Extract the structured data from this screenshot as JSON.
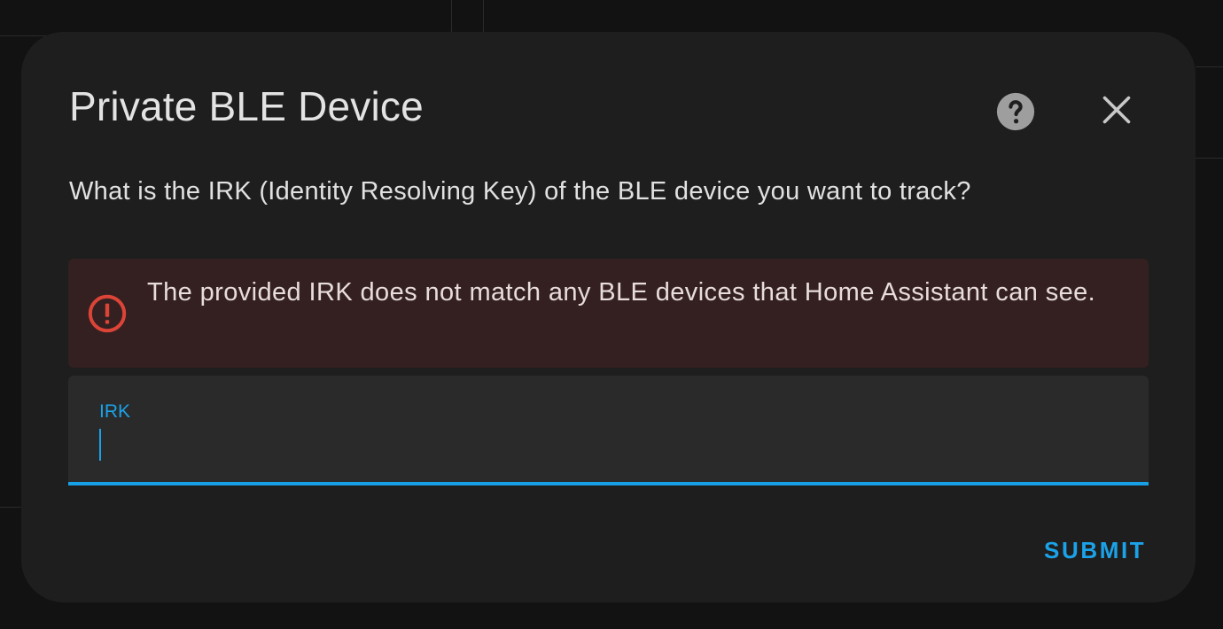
{
  "dialog": {
    "title": "Private BLE Device",
    "help_icon": "help-circle-icon",
    "close_icon": "close-icon",
    "description": "What is the IRK (Identity Resolving Key) of the BLE device you want to track?"
  },
  "alert": {
    "icon": "alert-circle-outline-icon",
    "message": "The provided IRK does not match any BLE devices that Home Assistant can see.",
    "color": "#db4437"
  },
  "form": {
    "irk_field": {
      "label": "IRK",
      "value": ""
    },
    "submit_label": "SUBMIT"
  },
  "colors": {
    "accent": "#1ba2e8",
    "dialog_bg": "#1e1e1e",
    "alert_bg": "#342020",
    "field_bg": "#2a2a2a"
  }
}
